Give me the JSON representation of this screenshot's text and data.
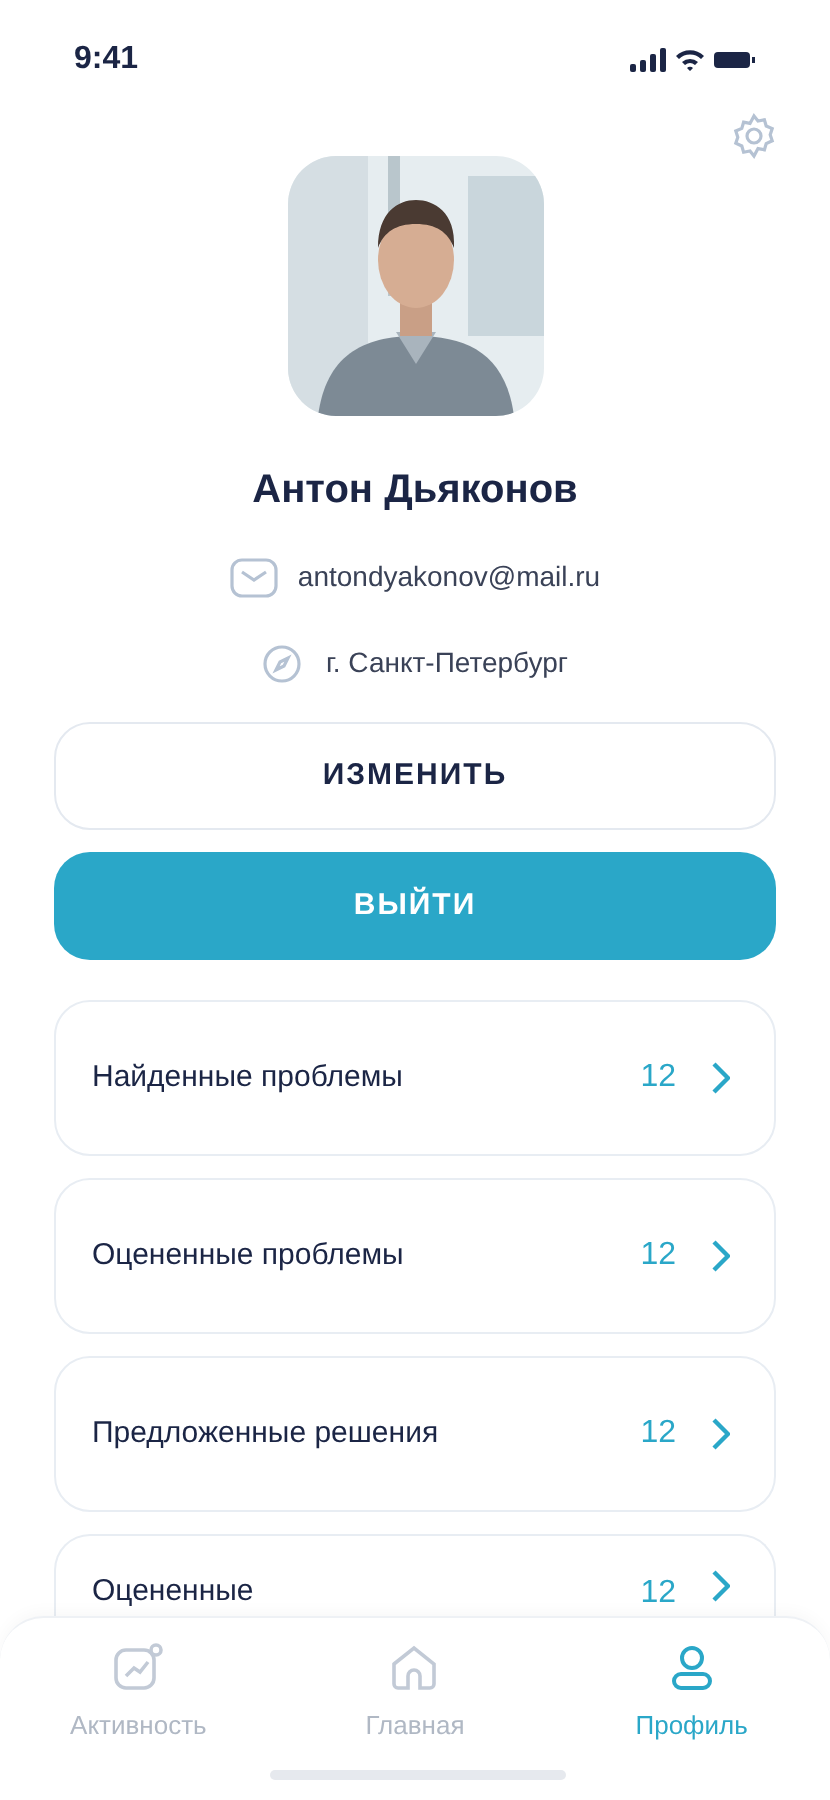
{
  "status_bar": {
    "time": "9:41"
  },
  "profile": {
    "name": "Антон Дьяконов",
    "email": "antondyakonov@mail.ru",
    "city": "г. Санкт-Петербург"
  },
  "buttons": [
    {
      "label": "ИЗМЕНИТЬ",
      "kind": "outline"
    },
    {
      "label": "ВЫЙТИ",
      "kind": "filled"
    }
  ],
  "stats": [
    {
      "label": "Найденные проблемы",
      "count": "12"
    },
    {
      "label": "Оцененные проблемы",
      "count": "12"
    },
    {
      "label": "Предложенные решения",
      "count": "12"
    },
    {
      "label": "Оцененные",
      "count": "12"
    }
  ],
  "tab_bar": [
    {
      "label": "Активность",
      "kind": "activity",
      "selected": false
    },
    {
      "label": "Главная",
      "kind": "home",
      "selected": false
    },
    {
      "label": "Профиль",
      "kind": "profile",
      "selected": true
    }
  ]
}
